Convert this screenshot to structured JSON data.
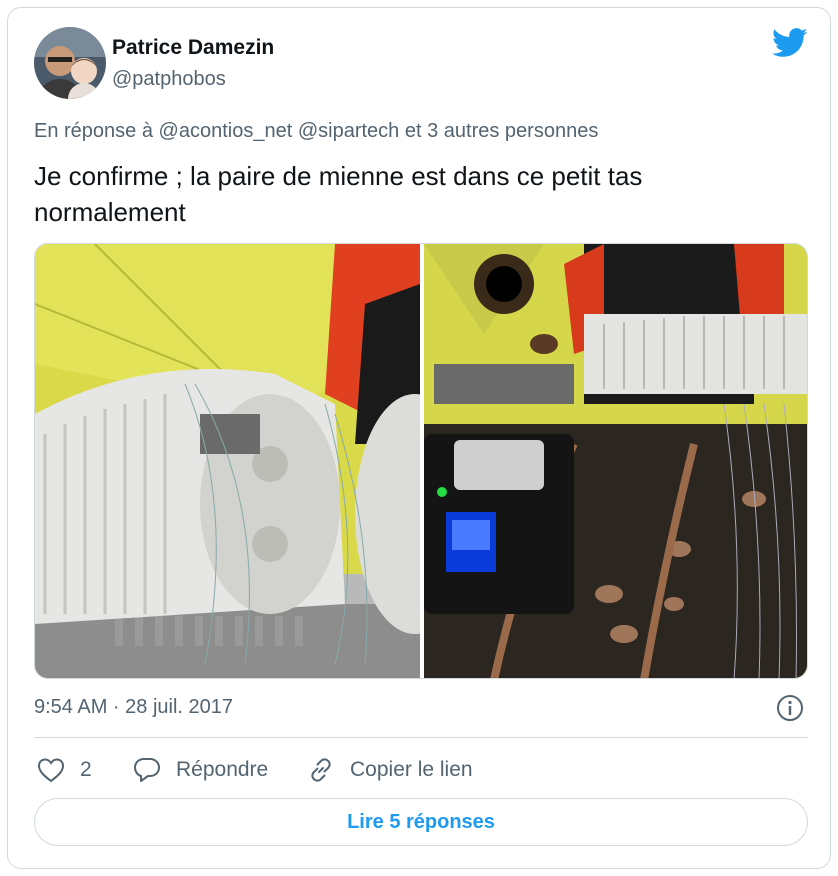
{
  "author": {
    "name": "Patrice Damezin",
    "handle": "@patphobos"
  },
  "reply_context": {
    "prefix": "En réponse à",
    "mentions": [
      "@acontios_net",
      "@sipartech"
    ],
    "suffix": "et 3 autres personnes"
  },
  "tweet": {
    "text": "Je confirme ; la paire de mienne est dans ce petit tas normalement",
    "timestamp": "9:54 AM · 28 juil. 2017"
  },
  "actions": {
    "like_count": "2",
    "reply_label": "Répondre",
    "copy_link_label": "Copier le lien"
  },
  "read_replies_label": "Lire 5 réponses",
  "icons": {
    "logo": "twitter-bird-icon",
    "info": "info-icon",
    "like": "heart-icon",
    "reply": "speech-bubble-icon",
    "copy": "link-icon"
  },
  "colors": {
    "brand": "#1d9bf0",
    "text": "#0f1419",
    "secondary": "#536471",
    "border": "#cfd9de"
  }
}
